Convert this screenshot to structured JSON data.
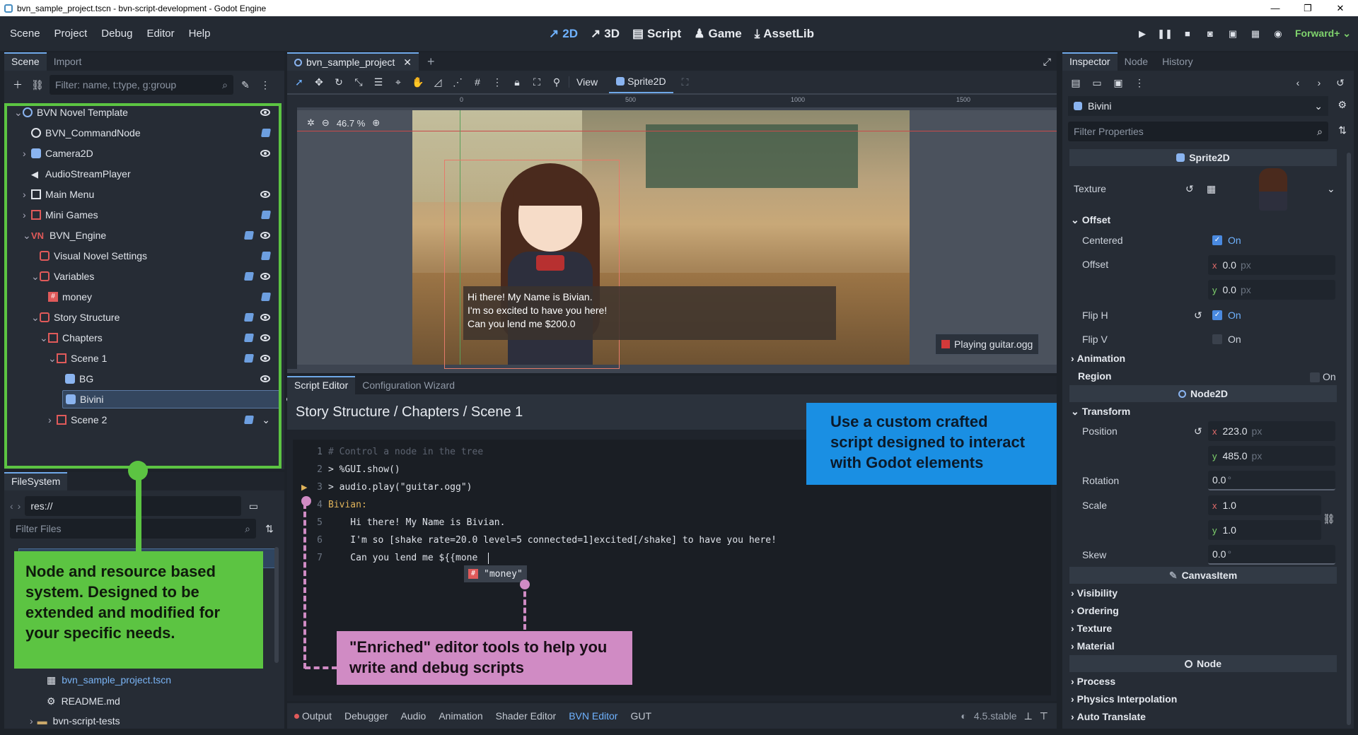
{
  "window": {
    "title": "bvn_sample_project.tscn - bvn-script-development - Godot Engine"
  },
  "menu": [
    "Scene",
    "Project",
    "Debug",
    "Editor",
    "Help"
  ],
  "workspaces": [
    "2D",
    "3D",
    "Script",
    "Game",
    "AssetLib"
  ],
  "renderer": "Forward+",
  "scene_dock": {
    "tabs": [
      "Scene",
      "Import"
    ],
    "filter_placeholder": "Filter: name, t:type, g:group",
    "nodes": [
      {
        "name": "BVN Novel Template"
      },
      {
        "name": "BVN_CommandNode"
      },
      {
        "name": "Camera2D"
      },
      {
        "name": "AudioStreamPlayer"
      },
      {
        "name": "Main Menu"
      },
      {
        "name": "Mini Games"
      },
      {
        "name": "BVN_Engine"
      },
      {
        "name": "Visual Novel Settings"
      },
      {
        "name": "Variables"
      },
      {
        "name": "money"
      },
      {
        "name": "Story Structure"
      },
      {
        "name": "Chapters"
      },
      {
        "name": "Scene 1"
      },
      {
        "name": "BG"
      },
      {
        "name": "Bivini"
      },
      {
        "name": "Scene 2"
      }
    ]
  },
  "filesystem": {
    "tab": "FileSystem",
    "path": "res://",
    "filter_placeholder": "Filter Files",
    "files": [
      "bvn_sample_project.tscn",
      "README.md",
      "bvn-script-tests"
    ]
  },
  "callouts": {
    "green": "Node and resource based system. Designed to be extended and modified for your specific needs.",
    "blue": "Use a custom crafted script designed to interact with Godot elements",
    "pink": "\"Enriched\" editor tools to help you write and debug scripts"
  },
  "viewport": {
    "tab": "bvn_sample_project",
    "view_label": "View",
    "selected_node": "Sprite2D",
    "zoom": "46.7 %",
    "ruler": [
      "0",
      "500",
      "1000",
      "1500"
    ],
    "dialog": [
      "Hi there! My Name is Bivian.",
      "I'm so excited to have you here!",
      "Can you lend me $200.0"
    ],
    "audio_badge": "Playing guitar.ogg"
  },
  "script_editor": {
    "tabs": [
      "Script Editor",
      "Configuration Wizard"
    ],
    "breadcrumb": "Story Structure / Chapters / Scene 1",
    "lines": [
      {
        "n": "1",
        "text": "# Control a node in the tree",
        "color": "#5c6370"
      },
      {
        "n": "2",
        "text": "> %GUI.show()",
        "color": "#dfe3ea"
      },
      {
        "n": "3",
        "text": "> audio.play(\"guitar.ogg\")",
        "color": "#dfe3ea"
      },
      {
        "n": "4",
        "text": "Bivian:",
        "color": "#e0b35a"
      },
      {
        "n": "5",
        "text": "    Hi there! My Name is Bivian.",
        "color": "#dfe3ea"
      },
      {
        "n": "6",
        "text": "    I'm so [shake rate=20.0 level=5 connected=1]excited[/shake] to have you here!",
        "color": "#dfe3ea"
      },
      {
        "n": "7",
        "text": "    Can you lend me ${{mone",
        "color": "#dfe3ea"
      }
    ],
    "autocomplete": "\"money\""
  },
  "bottom_panel": {
    "tabs": [
      "Output",
      "Debugger",
      "Audio",
      "Animation",
      "Shader Editor",
      "BVN Editor",
      "GUT"
    ],
    "version": "4.5.stable"
  },
  "inspector": {
    "tabs": [
      "Inspector",
      "Node",
      "History"
    ],
    "object": "Bivini",
    "filter_placeholder": "Filter Properties",
    "sections": {
      "sprite": "Sprite2D",
      "node2d": "Node2D",
      "canvas": "CanvasItem",
      "node": "Node"
    },
    "texture_label": "Texture",
    "offset_group": "Offset",
    "centered": {
      "label": "Centered",
      "value": "On"
    },
    "offset": {
      "label": "Offset",
      "x": "0.0",
      "y": "0.0",
      "unit": "px"
    },
    "flip_h": {
      "label": "Flip H",
      "value": "On"
    },
    "flip_v": {
      "label": "Flip V",
      "value": "On"
    },
    "animation": "Animation",
    "region": {
      "label": "Region",
      "value": "On"
    },
    "transform_group": "Transform",
    "position": {
      "label": "Position",
      "x": "223.0",
      "y": "485.0",
      "unit": "px"
    },
    "rotation": {
      "label": "Rotation",
      "value": "0.0",
      "unit": "°"
    },
    "scale": {
      "label": "Scale",
      "x": "1.0",
      "y": "1.0"
    },
    "skew": {
      "label": "Skew",
      "value": "0.0",
      "unit": "°"
    },
    "canvas_groups": [
      "Visibility",
      "Ordering",
      "Texture",
      "Material"
    ],
    "node_groups": [
      "Process",
      "Physics Interpolation",
      "Auto Translate"
    ]
  },
  "colors": {
    "accent": "#6fb2ff",
    "green": "#5cc442",
    "blue": "#1a8fe3",
    "pink": "#d08bc4"
  }
}
